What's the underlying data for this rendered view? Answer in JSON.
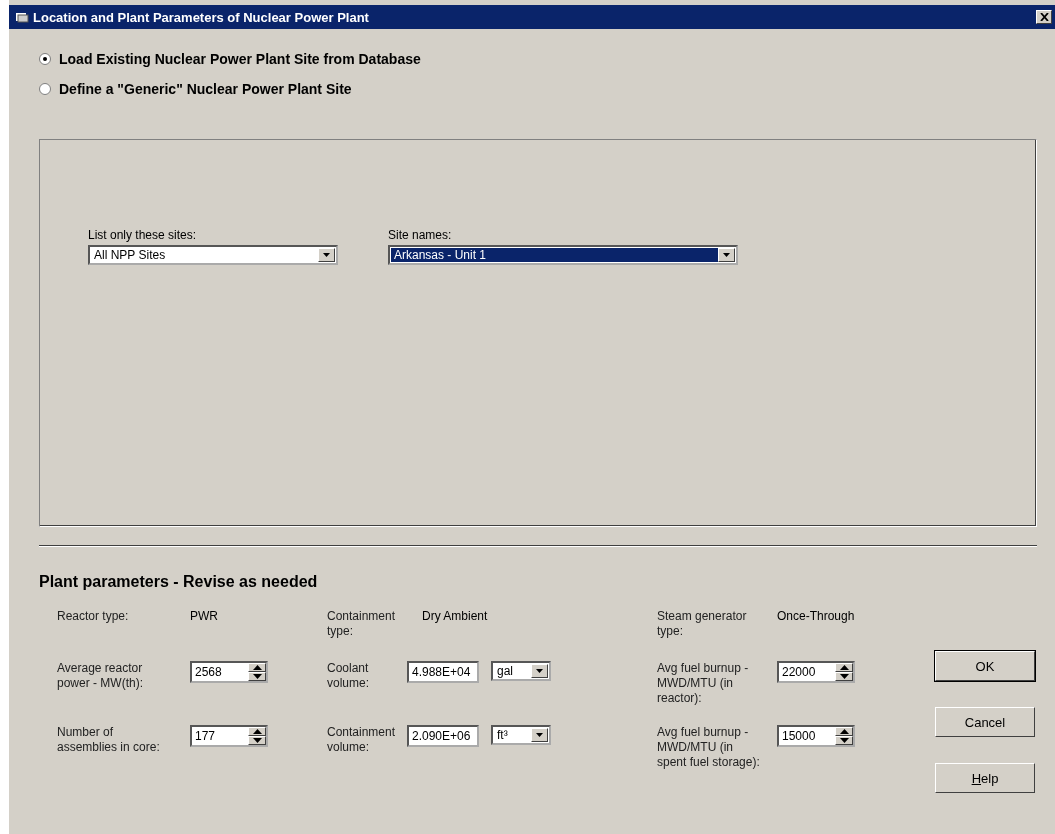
{
  "window": {
    "title": "Location and Plant Parameters of Nuclear Power Plant"
  },
  "source_options": [
    {
      "label": "Load Existing Nuclear Power Plant Site from Database",
      "selected": true
    },
    {
      "label": "Define a \"Generic\" Nuclear Power Plant Site",
      "selected": false
    }
  ],
  "site_panel": {
    "dropdowns": [
      {
        "label": "List only these sites:",
        "value": "All NPP Sites",
        "highlighted": false
      },
      {
        "label": "Site names:",
        "value": "Arkansas - Unit 1",
        "highlighted": true
      }
    ]
  },
  "plant_parameters": {
    "heading": "Plant parameters - Revise as needed",
    "items": [
      {
        "kind": "text",
        "label": "Reactor type:",
        "value": "PWR"
      },
      {
        "kind": "text",
        "label": "Containment type:",
        "value": "Dry Ambient"
      },
      {
        "kind": "text",
        "label": "Steam generator type:",
        "value": "Once-Through"
      },
      {
        "kind": "spin",
        "label": "Average reactor power - MW(th):",
        "value": "2568"
      },
      {
        "kind": "unit",
        "label": "Coolant volume:",
        "value": "4.988E+04",
        "unit": "gal"
      },
      {
        "kind": "spin",
        "label": "Avg fuel burnup - MWD/MTU (in reactor):",
        "value": "22000"
      },
      {
        "kind": "spin",
        "label": "Number of assemblies in core:",
        "value": "177"
      },
      {
        "kind": "unit",
        "label": "Containment volume:",
        "value": "2.090E+06",
        "unit": "ft³"
      },
      {
        "kind": "spin",
        "label": "Avg fuel burnup - MWD/MTU (in spent fuel storage):",
        "value": "15000"
      }
    ]
  },
  "buttons": [
    {
      "label": "OK",
      "default": true,
      "underline_first": false
    },
    {
      "label": "Cancel",
      "default": false,
      "underline_first": false
    },
    {
      "label": "Help",
      "default": false,
      "underline_first": true
    }
  ]
}
